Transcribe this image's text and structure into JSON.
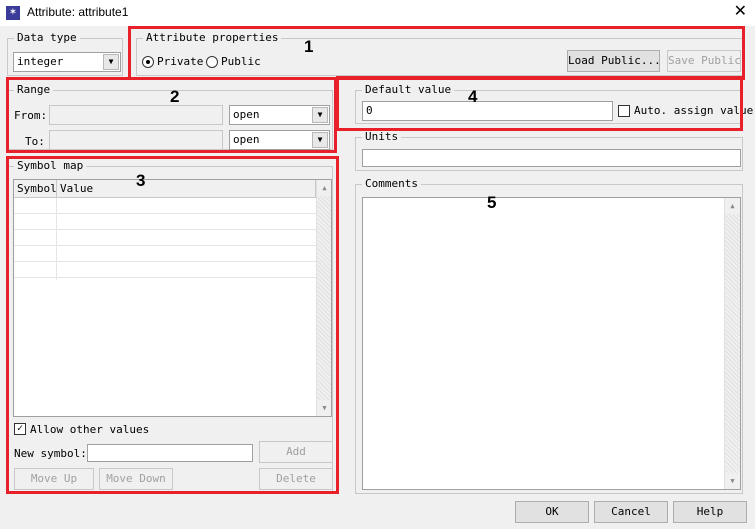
{
  "window": {
    "title": "Attribute: attribute1",
    "close_glyph": "✕",
    "icon": "app-star-icon"
  },
  "data_type": {
    "legend": "Data type",
    "value": "integer"
  },
  "attribute_properties": {
    "legend": "Attribute properties",
    "private_label": "Private",
    "public_label": "Public",
    "selected": "Private",
    "load_public": "Load Public...",
    "save_public": "Save Public"
  },
  "range": {
    "legend": "Range",
    "from_label": "From:",
    "to_label": "To:",
    "from_value": "",
    "to_value": "",
    "from_bound": "open",
    "to_bound": "open"
  },
  "symbol_map": {
    "legend": "Symbol map",
    "columns": [
      "Symbol",
      "Value"
    ],
    "rows": [
      [
        "",
        ""
      ],
      [
        "",
        ""
      ],
      [
        "",
        ""
      ],
      [
        "",
        ""
      ],
      [
        "",
        ""
      ]
    ],
    "allow_other_values": "Allow other values",
    "allow_other_checked": true,
    "new_symbol_label": "New symbol:",
    "new_symbol_value": "",
    "add": "Add",
    "move_up": "Move Up",
    "move_down": "Move Down",
    "delete": "Delete"
  },
  "default_value": {
    "legend": "Default value",
    "value": "0",
    "auto_assign": "Auto. assign value",
    "auto_assign_checked": false
  },
  "units": {
    "legend": "Units",
    "value": ""
  },
  "comments": {
    "legend": "Comments",
    "value": ""
  },
  "footer": {
    "ok": "OK",
    "cancel": "Cancel",
    "help": "Help"
  },
  "annotations": [
    "1",
    "2",
    "3",
    "4",
    "5"
  ],
  "colors": {
    "annotation_border": "#e8202a"
  }
}
